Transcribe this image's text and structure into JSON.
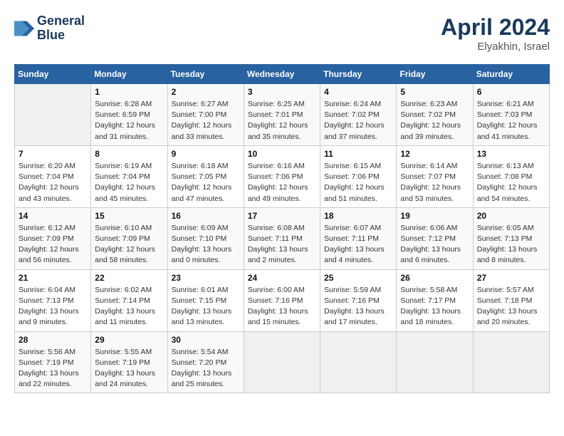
{
  "header": {
    "logo_line1": "General",
    "logo_line2": "Blue",
    "month": "April 2024",
    "location": "Elyakhin, Israel"
  },
  "days_of_week": [
    "Sunday",
    "Monday",
    "Tuesday",
    "Wednesday",
    "Thursday",
    "Friday",
    "Saturday"
  ],
  "weeks": [
    [
      {
        "day": "",
        "info": ""
      },
      {
        "day": "1",
        "info": "Sunrise: 6:28 AM\nSunset: 6:59 PM\nDaylight: 12 hours\nand 31 minutes."
      },
      {
        "day": "2",
        "info": "Sunrise: 6:27 AM\nSunset: 7:00 PM\nDaylight: 12 hours\nand 33 minutes."
      },
      {
        "day": "3",
        "info": "Sunrise: 6:25 AM\nSunset: 7:01 PM\nDaylight: 12 hours\nand 35 minutes."
      },
      {
        "day": "4",
        "info": "Sunrise: 6:24 AM\nSunset: 7:02 PM\nDaylight: 12 hours\nand 37 minutes."
      },
      {
        "day": "5",
        "info": "Sunrise: 6:23 AM\nSunset: 7:02 PM\nDaylight: 12 hours\nand 39 minutes."
      },
      {
        "day": "6",
        "info": "Sunrise: 6:21 AM\nSunset: 7:03 PM\nDaylight: 12 hours\nand 41 minutes."
      }
    ],
    [
      {
        "day": "7",
        "info": "Sunrise: 6:20 AM\nSunset: 7:04 PM\nDaylight: 12 hours\nand 43 minutes."
      },
      {
        "day": "8",
        "info": "Sunrise: 6:19 AM\nSunset: 7:04 PM\nDaylight: 12 hours\nand 45 minutes."
      },
      {
        "day": "9",
        "info": "Sunrise: 6:18 AM\nSunset: 7:05 PM\nDaylight: 12 hours\nand 47 minutes."
      },
      {
        "day": "10",
        "info": "Sunrise: 6:16 AM\nSunset: 7:06 PM\nDaylight: 12 hours\nand 49 minutes."
      },
      {
        "day": "11",
        "info": "Sunrise: 6:15 AM\nSunset: 7:06 PM\nDaylight: 12 hours\nand 51 minutes."
      },
      {
        "day": "12",
        "info": "Sunrise: 6:14 AM\nSunset: 7:07 PM\nDaylight: 12 hours\nand 53 minutes."
      },
      {
        "day": "13",
        "info": "Sunrise: 6:13 AM\nSunset: 7:08 PM\nDaylight: 12 hours\nand 54 minutes."
      }
    ],
    [
      {
        "day": "14",
        "info": "Sunrise: 6:12 AM\nSunset: 7:09 PM\nDaylight: 12 hours\nand 56 minutes."
      },
      {
        "day": "15",
        "info": "Sunrise: 6:10 AM\nSunset: 7:09 PM\nDaylight: 12 hours\nand 58 minutes."
      },
      {
        "day": "16",
        "info": "Sunrise: 6:09 AM\nSunset: 7:10 PM\nDaylight: 13 hours\nand 0 minutes."
      },
      {
        "day": "17",
        "info": "Sunrise: 6:08 AM\nSunset: 7:11 PM\nDaylight: 13 hours\nand 2 minutes."
      },
      {
        "day": "18",
        "info": "Sunrise: 6:07 AM\nSunset: 7:11 PM\nDaylight: 13 hours\nand 4 minutes."
      },
      {
        "day": "19",
        "info": "Sunrise: 6:06 AM\nSunset: 7:12 PM\nDaylight: 13 hours\nand 6 minutes."
      },
      {
        "day": "20",
        "info": "Sunrise: 6:05 AM\nSunset: 7:13 PM\nDaylight: 13 hours\nand 8 minutes."
      }
    ],
    [
      {
        "day": "21",
        "info": "Sunrise: 6:04 AM\nSunset: 7:13 PM\nDaylight: 13 hours\nand 9 minutes."
      },
      {
        "day": "22",
        "info": "Sunrise: 6:02 AM\nSunset: 7:14 PM\nDaylight: 13 hours\nand 11 minutes."
      },
      {
        "day": "23",
        "info": "Sunrise: 6:01 AM\nSunset: 7:15 PM\nDaylight: 13 hours\nand 13 minutes."
      },
      {
        "day": "24",
        "info": "Sunrise: 6:00 AM\nSunset: 7:16 PM\nDaylight: 13 hours\nand 15 minutes."
      },
      {
        "day": "25",
        "info": "Sunrise: 5:59 AM\nSunset: 7:16 PM\nDaylight: 13 hours\nand 17 minutes."
      },
      {
        "day": "26",
        "info": "Sunrise: 5:58 AM\nSunset: 7:17 PM\nDaylight: 13 hours\nand 18 minutes."
      },
      {
        "day": "27",
        "info": "Sunrise: 5:57 AM\nSunset: 7:18 PM\nDaylight: 13 hours\nand 20 minutes."
      }
    ],
    [
      {
        "day": "28",
        "info": "Sunrise: 5:56 AM\nSunset: 7:19 PM\nDaylight: 13 hours\nand 22 minutes."
      },
      {
        "day": "29",
        "info": "Sunrise: 5:55 AM\nSunset: 7:19 PM\nDaylight: 13 hours\nand 24 minutes."
      },
      {
        "day": "30",
        "info": "Sunrise: 5:54 AM\nSunset: 7:20 PM\nDaylight: 13 hours\nand 25 minutes."
      },
      {
        "day": "",
        "info": ""
      },
      {
        "day": "",
        "info": ""
      },
      {
        "day": "",
        "info": ""
      },
      {
        "day": "",
        "info": ""
      }
    ]
  ]
}
